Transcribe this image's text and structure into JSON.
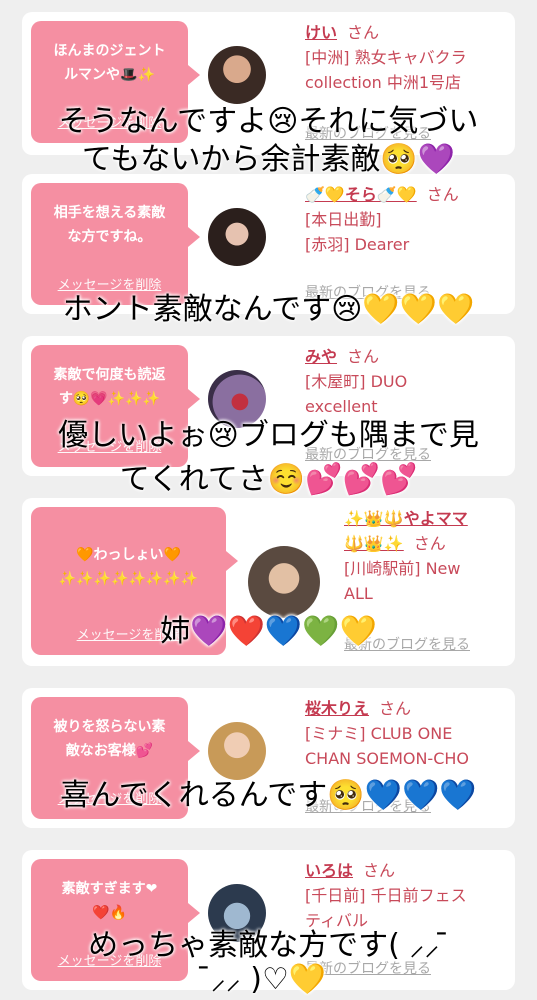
{
  "cards": [
    {
      "bubble_text": "ほんまのジェント\nルマンや🎩✨",
      "delete_label": "メッセージを削除",
      "cast_name": "けい",
      "san": "さん",
      "shop_lines": "[中洲] 熟女キャバクラ\ncollection 中洲1号店",
      "blog_label": "最新のブログを見る"
    },
    {
      "bubble_text": "相手を想える素敵\nな方ですね。",
      "delete_label": "メッセージを削除",
      "cast_name": "🍼💛そら🍼💛",
      "san": "さん",
      "shop_lines": "[本日出勤]\n[赤羽] Dearer",
      "blog_label": "最新のブログを見る"
    },
    {
      "bubble_text": "素敵で何度も読返\nす🥺💗✨✨✨",
      "delete_label": "メッセージを削除",
      "cast_name": "みや",
      "san": "さん",
      "shop_lines": "[木屋町] DUO\nexcellent",
      "blog_label": "最新のブログを見る"
    },
    {
      "bubble_text": "🧡わっしょい🧡\n✨✨✨✨✨✨✨✨",
      "delete_label": "メッセージを削除",
      "cast_name": "✨👑🔱やよママ",
      "cast_name_2": "🔱👑✨",
      "san": "さん",
      "shop_lines": "[川崎駅前] New\nALL",
      "blog_label": "最新のブログを見る"
    },
    {
      "bubble_text": "被りを怒らない素\n敵なお客様💕",
      "delete_label": "メッセージを削除",
      "cast_name": "桜木りえ",
      "san": "さん",
      "shop_lines": "[ミナミ] CLUB ONE\nCHAN SOEMON-CHO",
      "blog_label": "最新のブログを見る"
    },
    {
      "bubble_text": "素敵すぎます❤\n❤️🔥",
      "delete_label": "メッセージを削除",
      "cast_name": "いろは",
      "san": "さん",
      "shop_lines": "[千日前] 千日前フェス\nティバル",
      "blog_label": "最新のブログを見る"
    }
  ],
  "captions": [
    "そうなんですよ😢それに気づい",
    "てもないから余計素敵🥺💜",
    "ホント素敵なんです😢💛💛💛",
    "優しいよぉ😢ブログも隅まで見",
    "てくれてさ☺️💕💕💕",
    "姉💜❤️💙💚💛",
    "喜んでくれるんです🥺💙💙💙",
    "めっちゃ素敵な方です( ⸝⸝ ̄",
    " ̄⸝⸝ )♡💛"
  ],
  "colors": {
    "bubble": "#f58fa2",
    "name": "#c43a50",
    "shop": "#c84a5a",
    "link": "#a8a8a8",
    "background": "#efefef"
  }
}
